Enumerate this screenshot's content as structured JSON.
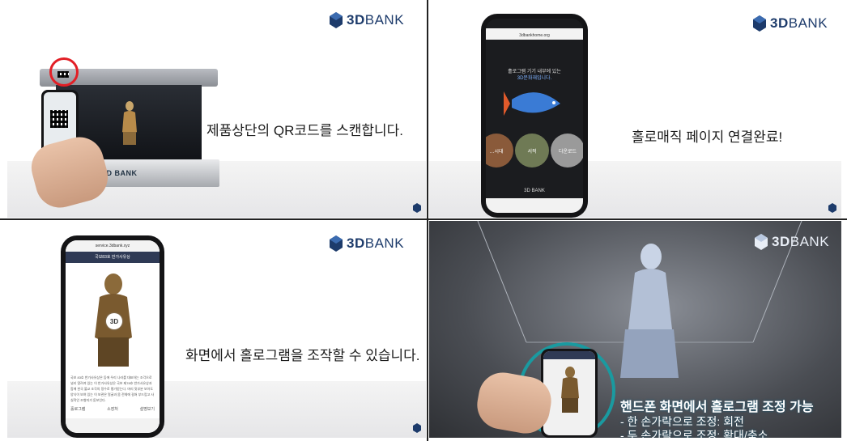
{
  "brand": {
    "logo_bold": "3D",
    "logo_rest": "BANK"
  },
  "panels": [
    {
      "caption": "제품상단의 QR코드를 스캔합니다.",
      "device_label": "3D BANK"
    },
    {
      "caption": "홀로매직 페이지 연결완료!",
      "phone_url": "3dbankhome.org",
      "phone_title_line1": "홀로그램 기기 내부에 있는",
      "phone_title_line2": "3D문화재입니다.",
      "cards": [
        "…시대",
        "서적",
        "다운로드"
      ],
      "phone_footer": "3D BANK"
    },
    {
      "caption": "화면에서 홀로그램을 조작할 수 있습니다.",
      "phone_url": "service.3dbank.xyz",
      "phone_header": "국보83호 반가사유상",
      "badge": "3D",
      "body_text": "국보 83호 반가사유상은 등에 우리 나라를 대표하는 조각으로 널리 알려져 있는 이 반가사유상은 국보 제78호 반가사유상과 함께 한국 불교 조각의 정수로 평가받는다. 머리 뒷부분 보아도 양식이 보여 있는 이 보관은 얼굴과 몸 전체에 걸쳐 부드럽고 사실적인 조형미가 돋보인다.",
      "actions": [
        "홀로그램",
        "소장처",
        "설명보기"
      ]
    },
    {
      "caption_main": "핸드폰 화면에서 홀로그램 조정 가능",
      "caption_line1": "- 한 손가락으로 조정: 회전",
      "caption_line2": "- 두 손가락으로 조정: 확대/축소"
    }
  ],
  "colors": {
    "brand": "#1d3b6b",
    "highlight_ring": "#e21f26",
    "teal_ring": "#1a9aa0"
  }
}
